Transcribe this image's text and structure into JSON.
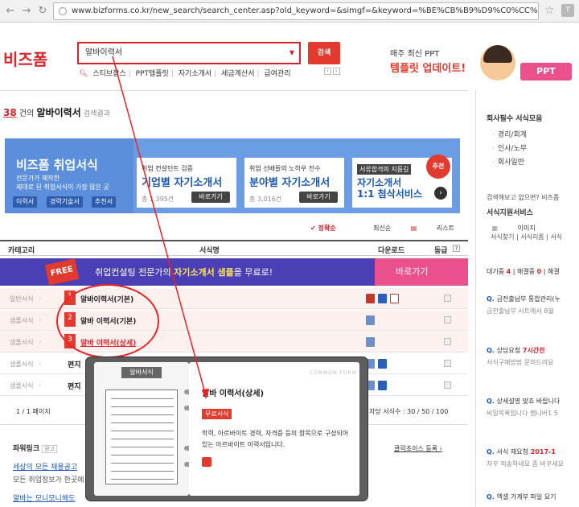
{
  "browser": {
    "url": "www.bizforms.co.kr/new_search/search_center.asp?old_keyword=&simgf=&keyword=%BE%CB%B9%D9%C0%CC%B7%C..."
  },
  "header": {
    "logo": "비즈폼",
    "search_value": "알바이력서",
    "search_button": "검색",
    "categories": [
      "스티브잡스",
      "PPT템플릿",
      "자기소개서",
      "세금계산서",
      "급여관리"
    ],
    "promo_small": "매주 최신 PPT",
    "promo_big": "템플릿 업데이트!",
    "ppt_badge": "PPT"
  },
  "results": {
    "count": "38",
    "count_suffix": "건의",
    "keyword": "알바이력서",
    "suffix": "검색결과"
  },
  "banner": {
    "title": "비즈폼 취업서식",
    "sub1": "전문가가 제작한",
    "sub2": "제대로 된 취업서식이 가장 많은 곳",
    "buttons": [
      "이력서",
      "경력기술서",
      "추천서"
    ],
    "card1": {
      "t1": "취업 컨설턴트 검증",
      "t2": "기업별 자기소개서",
      "t3": "총 1,395건",
      "btn": "바로가기"
    },
    "card2": {
      "t1": "취업 선배들의 노하우 전수",
      "t2": "분야별 자기소개서",
      "t3": "총 3,016건",
      "btn": "바로가기"
    },
    "card3": {
      "tag": "서류합격의 지름길",
      "t2a": "자기소개서",
      "t2b": "1:1 첨삭서비스"
    },
    "hot": "추천"
  },
  "sorts": [
    "정확순",
    "최신순",
    "리스트",
    "이미지"
  ],
  "table": {
    "headers": [
      "카테고리",
      "서식명",
      "다운로드",
      "등급"
    ],
    "free": "FREE",
    "free_text_a": "취업컨설팅 전문가",
    "free_text_b": "의",
    "free_text_c": "자기소개서 샘플",
    "free_text_d": "을 무료로!",
    "free_go": "바로가기",
    "rows": [
      {
        "cat": "일반서식",
        "name": "알바이력서(기본)",
        "rank": "1"
      },
      {
        "cat": "샘플서식",
        "name": "알바 이력서(기본)",
        "rank": "2"
      },
      {
        "cat": "샘플서식",
        "name": "알바 이력서(상세)",
        "rank": "3"
      },
      {
        "cat": "샘플서식",
        "name": "편지"
      },
      {
        "cat": "샘플서식",
        "name": "편지"
      }
    ]
  },
  "pager": {
    "left": "1 / 1 페이지",
    "right": "자당 서식수 : 30 / 50 / 100"
  },
  "power": {
    "label": "파워링크",
    "ad": "광고",
    "click": "클릭초이스 등록 ›",
    "links": [
      "세상의 모든 채용공고",
      "모든 취업정보가 한곳에",
      "알바는 모니모니해도"
    ]
  },
  "popup": {
    "label": "알바서식",
    "title": "알바 이력서(상세)",
    "tag": "무료서식",
    "desc": "학력, 아르바이트 경력, 자격증 등의 항목으로 구성되어있는 아르바이트 이력서입니다.",
    "watermark": "COMMON FORM"
  },
  "side": {
    "title": "회사필수 서식모음",
    "items": [
      "경리/회계",
      "인사/노무",
      "회사일반"
    ],
    "q1": "검색해보고 없으면? 비즈폼",
    "q2": "서식지원서비스",
    "tabs": "서식찾기 | 서식리폼 | 서식",
    "status_a": "대기중",
    "status_a_n": "4",
    "status_b": "해결중",
    "status_b_n": "0",
    "status_c": "해결",
    "qa": [
      {
        "q": "금전출납부 통합관리(누",
        "a": "금전출납부 시트에서 8월"
      },
      {
        "q": "상담요청",
        "time": "7시간전",
        "a": "서식구매방법 문의드려요"
      },
      {
        "q": "상세설명 맞죠 바랍니다",
        "a": "비밀목록입니다 쌤니버1 5"
      },
      {
        "q": "서식 재요청",
        "time": "2017-1",
        "a": "자꾸 죄송하네요 좀 바꾸세요"
      },
      {
        "q": "엑셀 가계부 파일 요기"
      }
    ]
  }
}
